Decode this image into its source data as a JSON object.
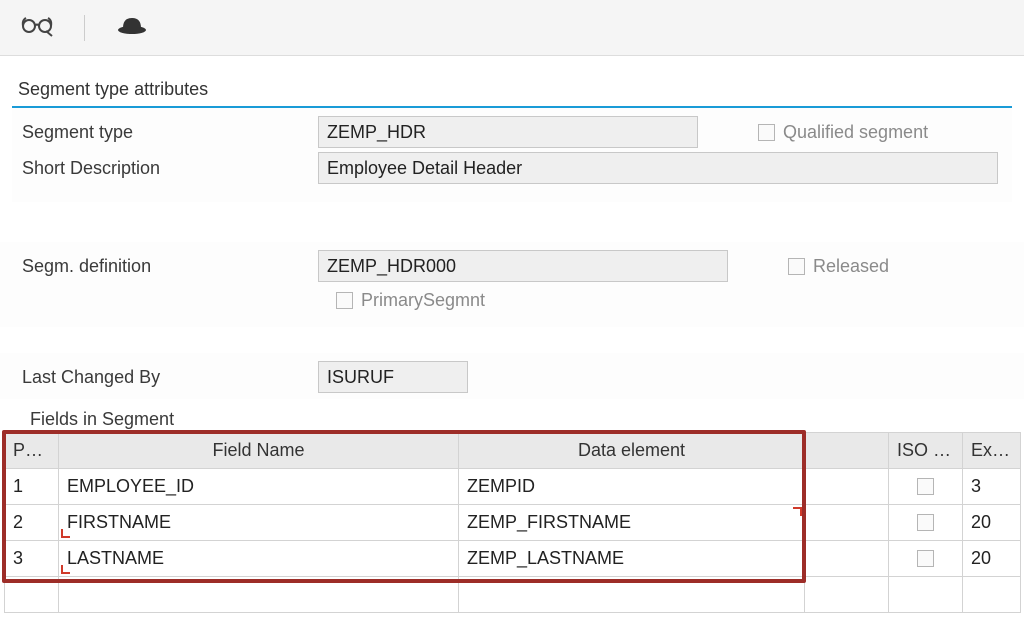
{
  "toolbar": {
    "icons": {
      "display": "glasses-icon",
      "hat": "hat-icon"
    }
  },
  "panel": {
    "title": "Segment type attributes",
    "segmentType": {
      "label": "Segment type",
      "value": "ZEMP_HDR"
    },
    "shortDesc": {
      "label": "Short Description",
      "value": "Employee Detail Header"
    },
    "qualified": {
      "label": "Qualified segment"
    }
  },
  "definition": {
    "label": "Segm. definition",
    "value": "ZEMP_HDR000",
    "released": {
      "label": "Released"
    },
    "primary": {
      "label": "PrimarySegmnt"
    }
  },
  "changedBy": {
    "label": "Last Changed By",
    "value": "ISURUF"
  },
  "fieldsTitle": "Fields in Segment",
  "table": {
    "headers": {
      "pos": "Po…",
      "fieldName": "Field Name",
      "dataElement": "Data element",
      "iso": "ISO c…",
      "ext": "Ex…"
    },
    "rows": [
      {
        "pos": "1",
        "fieldName": "EMPLOYEE_ID",
        "dataElement": "ZEMPID",
        "ext": "3"
      },
      {
        "pos": "2",
        "fieldName": "FIRSTNAME",
        "dataElement": "ZEMP_FIRSTNAME",
        "ext": "20"
      },
      {
        "pos": "3",
        "fieldName": "LASTNAME",
        "dataElement": "ZEMP_LASTNAME",
        "ext": "20"
      }
    ]
  }
}
